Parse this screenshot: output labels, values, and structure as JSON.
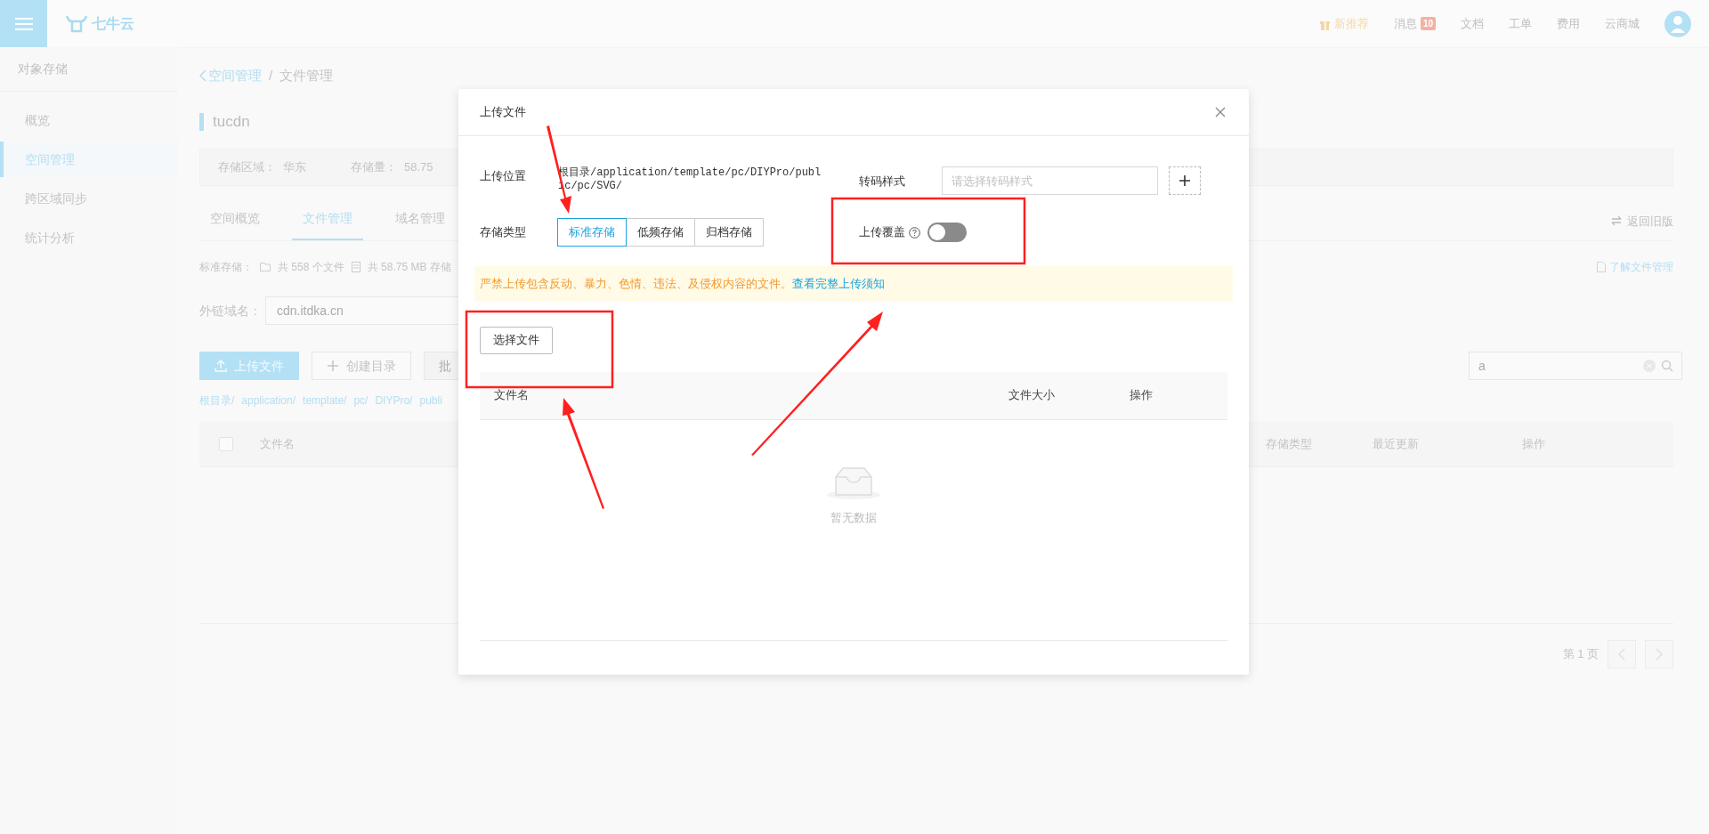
{
  "topbar": {
    "logo": "七牛云",
    "items": [
      {
        "label": "新推荐",
        "kind": "gift"
      },
      {
        "label": "消息",
        "kind": "message",
        "badge": "10"
      },
      {
        "label": "文档",
        "kind": "plain"
      },
      {
        "label": "工单",
        "kind": "plain"
      },
      {
        "label": "费用",
        "kind": "plain"
      },
      {
        "label": "云商城",
        "kind": "plain"
      }
    ]
  },
  "sidebar": {
    "title": "对象存储",
    "items": [
      {
        "label": "概览",
        "selected": false
      },
      {
        "label": "空间管理",
        "selected": true
      },
      {
        "label": "跨区域同步",
        "selected": false
      },
      {
        "label": "统计分析",
        "selected": false
      }
    ]
  },
  "breadcrumb": {
    "back": "空间管理",
    "separator": "/",
    "current": "文件管理"
  },
  "bucket_name": "tucdn",
  "info": [
    {
      "label": "存储区域：",
      "value": "华东"
    },
    {
      "label": "存储量：",
      "value": "58.75"
    }
  ],
  "tabs": [
    {
      "label": "空间概览",
      "selected": false
    },
    {
      "label": "文件管理",
      "selected": true
    },
    {
      "label": "域名管理",
      "selected": false
    }
  ],
  "switch_back": "返回旧版",
  "stats": {
    "label": "标准存储：",
    "files": "共 558 个文件",
    "size": "共 58.75 MB 存储"
  },
  "help_link": "了解文件管理",
  "domain": {
    "label": "外链域名：",
    "value": "cdn.itdka.cn"
  },
  "actions": [
    {
      "label": "上传文件",
      "kind": "upload"
    },
    {
      "label": "创建目录",
      "kind": "create"
    },
    {
      "label": "批",
      "kind": "disabled"
    }
  ],
  "search": {
    "value": "a"
  },
  "path": [
    "根目录/",
    "application/",
    "template/",
    "pc/",
    "DIYPro/",
    "publi"
  ],
  "table": {
    "select_all": {
      "checked": false
    },
    "columns": [
      "文件名",
      "存储类型",
      "最近更新",
      "操作"
    ]
  },
  "pagination": {
    "page": "第 1 页"
  },
  "modal": {
    "title": "上传文件",
    "location": {
      "label": "上传位置",
      "value": "根目录/application/template/pc/DIYPro/public/pc/SVG/"
    },
    "transcode": {
      "label": "转码样式",
      "placeholder": "请选择转码样式"
    },
    "storage": {
      "label": "存储类型",
      "options": [
        {
          "label": "标准存储",
          "selected": true
        },
        {
          "label": "低频存储",
          "selected": false
        },
        {
          "label": "归档存储",
          "selected": false
        }
      ]
    },
    "overwrite": {
      "label": "上传覆盖",
      "on": false
    },
    "notice": {
      "text": "严禁上传包含反动、暴力、色情、违法、及侵权内容的文件。",
      "link": "查看完整上传须知"
    },
    "choose_button": "选择文件",
    "columns": [
      "文件名",
      "文件大小",
      "操作"
    ],
    "empty": "暂无数据"
  }
}
